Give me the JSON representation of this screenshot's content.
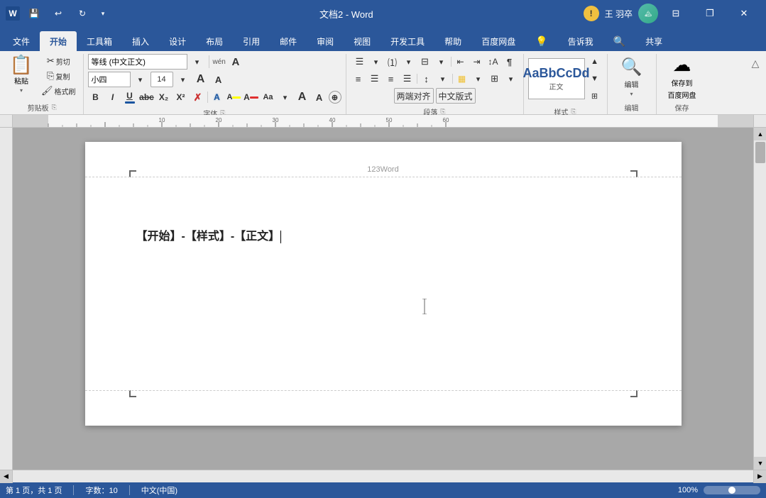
{
  "titleBar": {
    "title": "文档2 - Word",
    "quickButtons": [
      "💾",
      "↩",
      "↻",
      "⊞",
      "▾"
    ],
    "warningLabel": "!",
    "userName": "王 羽卒",
    "windowButtons": [
      "⊟",
      "❐",
      "✕"
    ]
  },
  "ribbonTabs": {
    "tabs": [
      "文件",
      "开始",
      "工具箱",
      "插入",
      "设计",
      "布局",
      "引用",
      "邮件",
      "审阅",
      "视图",
      "开发工具",
      "帮助",
      "百度网盘",
      "💡",
      "告诉我",
      "🔍",
      "共享"
    ],
    "activeTab": "开始"
  },
  "ribbon": {
    "groups": [
      {
        "name": "clipboard",
        "label": "剪贴板",
        "buttons": [
          "粘贴",
          "剪切",
          "复制",
          "格式刷"
        ]
      },
      {
        "name": "font",
        "label": "字体",
        "fontName": "等线 (中文正文)",
        "fontSize": "小四",
        "fontSizeNum": "14",
        "formatButtons": [
          "B",
          "I",
          "U",
          "ab̶c̶",
          "X₂",
          "X²",
          "清除"
        ]
      },
      {
        "name": "paragraph",
        "label": "段落"
      },
      {
        "name": "styles",
        "label": "样式",
        "styleLabel": "样式"
      },
      {
        "name": "editing",
        "label": "编辑",
        "editLabel": "编辑"
      },
      {
        "name": "save",
        "label": "保存",
        "saveLabel": "保存到\n百度网盘"
      }
    ]
  },
  "document": {
    "headerText": "123Word",
    "contentLine": "【开始】-【样式】-【正文】",
    "cursorVisible": true
  },
  "statusBar": {
    "pageInfo": "第 1 页，共 1 页",
    "wordCount": "字数：10",
    "language": "中文(中国)",
    "zoom": "100%"
  }
}
